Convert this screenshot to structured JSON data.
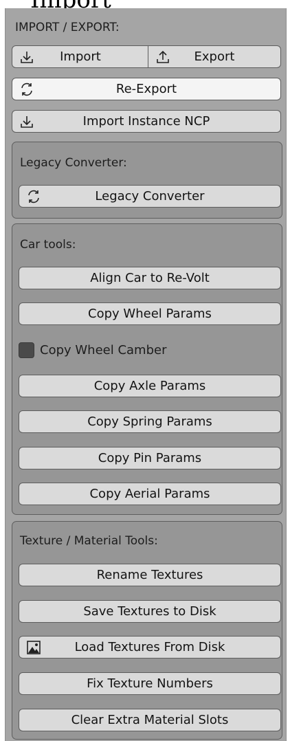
{
  "header": {
    "clipped_word": "Import"
  },
  "import_export": {
    "title": "IMPORT / EXPORT:",
    "import_label": "Import",
    "export_label": "Export",
    "reexport_label": "Re-Export",
    "import_ncp_label": "Import Instance NCP"
  },
  "legacy": {
    "title": "Legacy Converter:",
    "converter_label": "Legacy Converter"
  },
  "car_tools": {
    "title": "Car tools:",
    "align_label": "Align Car to Re-Volt",
    "copy_wheel_label": "Copy Wheel Params",
    "copy_camber_label": "Copy Wheel Camber",
    "copy_camber_checked": false,
    "copy_axle_label": "Copy Axle Params",
    "copy_spring_label": "Copy Spring Params",
    "copy_pin_label": "Copy Pin Params",
    "copy_aerial_label": "Copy Aerial Params"
  },
  "texture_tools": {
    "title": "Texture / Material Tools:",
    "rename_label": "Rename Textures",
    "save_label": "Save Textures to Disk",
    "load_label": "Load Textures From Disk",
    "fix_numbers_label": "Fix Texture Numbers",
    "clear_slots_label": "Clear Extra Material Slots"
  },
  "icons": {
    "import": "import-icon",
    "export": "export-icon",
    "refresh": "refresh-icon",
    "image": "image-icon"
  }
}
